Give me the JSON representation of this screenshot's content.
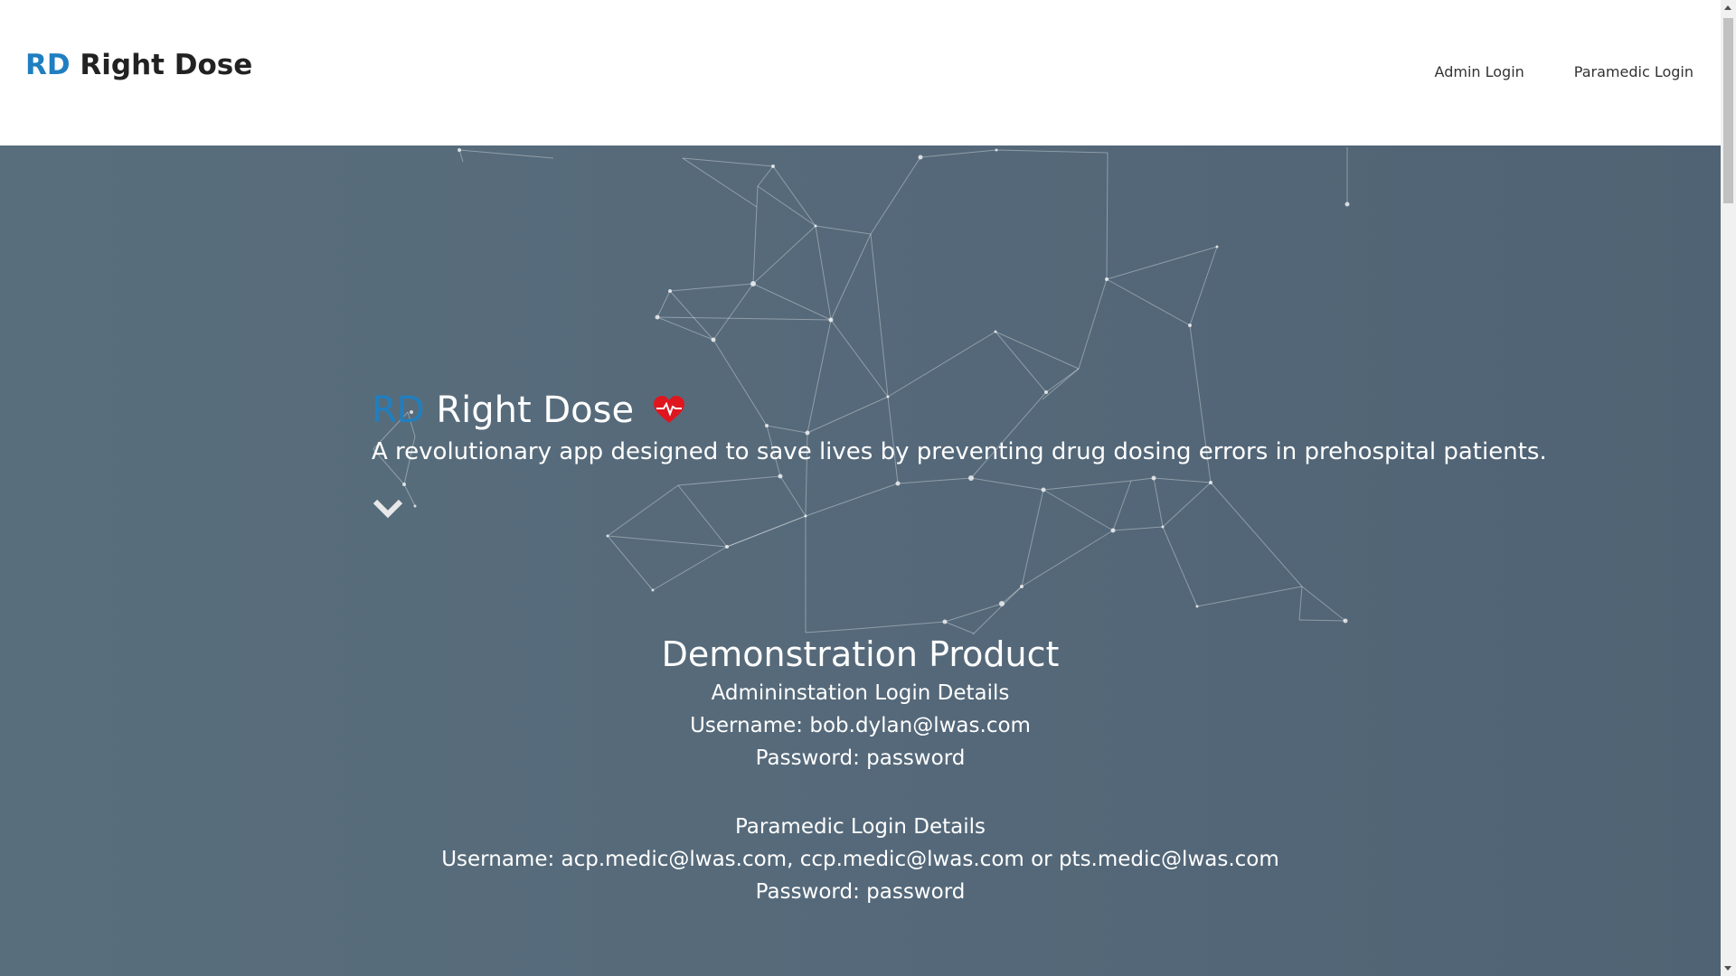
{
  "navbar": {
    "brand_abbr": "RD",
    "brand_name": "Right Dose",
    "links": [
      "Admin Login",
      "Paramedic Login"
    ]
  },
  "hero": {
    "title_abbr": "RD",
    "title_name": "Right Dose",
    "tagline": "A revolutionary app designed to save lives by preventing drug dosing errors in prehospital patients."
  },
  "demo": {
    "title": "Demonstration Product",
    "admin_heading": "Admininstation Login Details",
    "admin_username": "Username: bob.dylan@lwas.com",
    "admin_password": "Password: password",
    "paramedic_heading": "Paramedic Login Details",
    "paramedic_username": "Username: acp.medic@lwas.com, ccp.medic@lwas.com or pts.medic@lwas.com",
    "paramedic_password": "Password: password"
  },
  "colors": {
    "brand_blue": "#1f7fc0",
    "heart_red": "#e0161e",
    "hero_bg": "#55697a"
  },
  "icons": {
    "heart": "heartbeat-icon",
    "scroll_down": "chevron-down-icon"
  }
}
